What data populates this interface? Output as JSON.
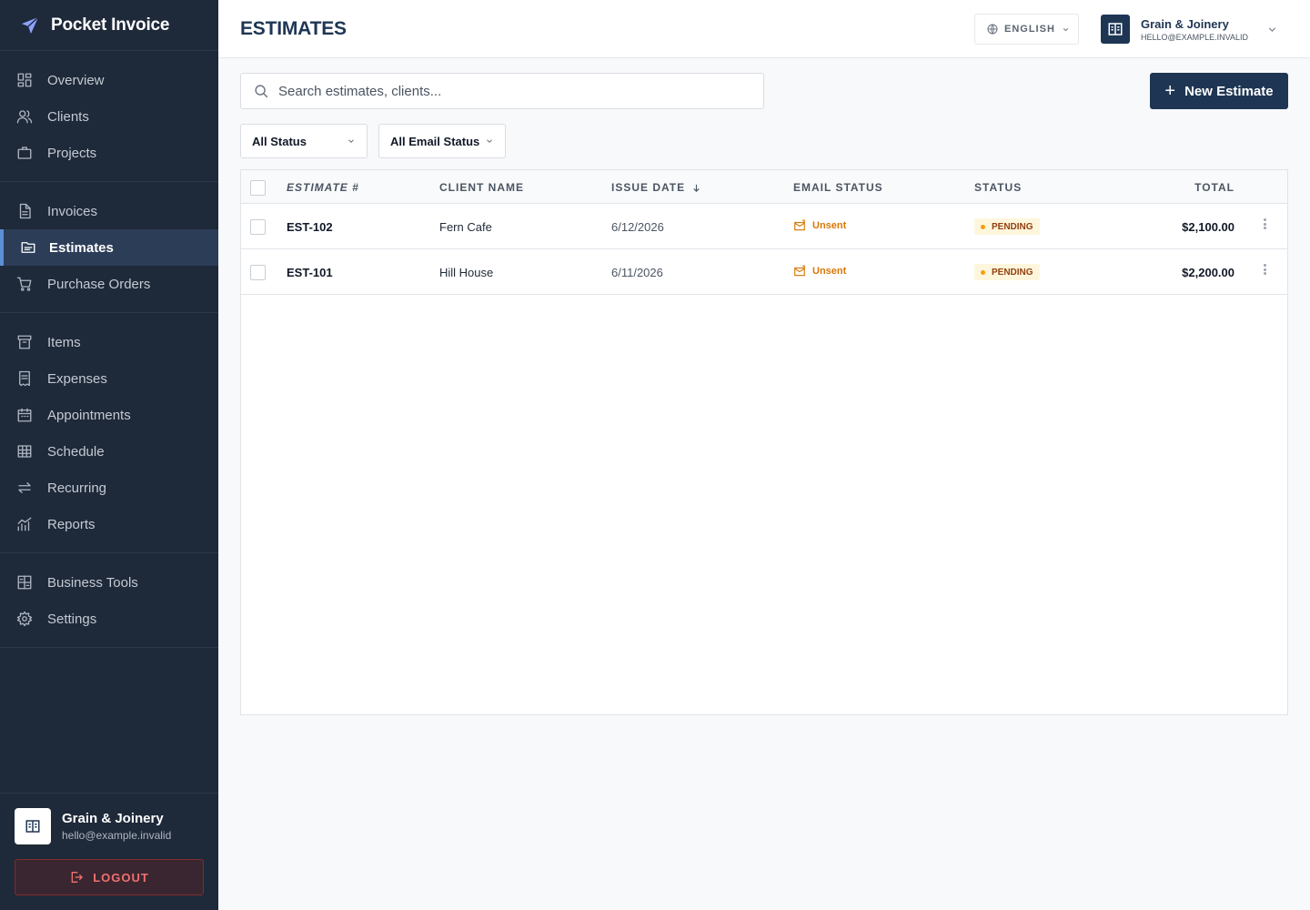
{
  "app": {
    "name": "Pocket Invoice"
  },
  "sidebar": {
    "groups": [
      [
        {
          "label": "Overview",
          "icon": "overview-icon"
        },
        {
          "label": "Clients",
          "icon": "clients-icon"
        },
        {
          "label": "Projects",
          "icon": "projects-icon"
        }
      ],
      [
        {
          "label": "Invoices",
          "icon": "invoices-icon"
        },
        {
          "label": "Estimates",
          "icon": "estimates-icon",
          "active": true
        },
        {
          "label": "Purchase Orders",
          "icon": "cart-icon"
        }
      ],
      [
        {
          "label": "Items",
          "icon": "items-icon"
        },
        {
          "label": "Expenses",
          "icon": "expenses-icon"
        },
        {
          "label": "Appointments",
          "icon": "calendar-icon"
        },
        {
          "label": "Schedule",
          "icon": "schedule-icon"
        },
        {
          "label": "Recurring",
          "icon": "recurring-icon"
        },
        {
          "label": "Reports",
          "icon": "reports-icon"
        }
      ],
      [
        {
          "label": "Business Tools",
          "icon": "tools-icon"
        },
        {
          "label": "Settings",
          "icon": "gear-icon"
        }
      ]
    ],
    "footer": {
      "business_name": "Grain & Joinery",
      "email": "hello@example.invalid",
      "logout_label": "LOGOUT"
    }
  },
  "header": {
    "title": "ESTIMATES",
    "language": "ENGLISH",
    "account_name": "Grain & Joinery",
    "account_email": "HELLO@EXAMPLE.INVALID"
  },
  "toolbar": {
    "search_placeholder": "Search estimates, clients...",
    "new_button_label": "New Estimate",
    "filter_status": "All Status",
    "filter_email_status": "All Email Status"
  },
  "table": {
    "columns": {
      "estimate": "ESTIMATE #",
      "client": "CLIENT NAME",
      "issue_date": "ISSUE DATE",
      "email_status": "EMAIL STATUS",
      "status": "STATUS",
      "total": "TOTAL"
    },
    "rows": [
      {
        "estimate": "EST-102",
        "client": "Fern Cafe",
        "issue_date": "6/12/2026",
        "email_status": "Unsent",
        "status": "PENDING",
        "total": "$2,100.00"
      },
      {
        "estimate": "EST-101",
        "client": "Hill House",
        "issue_date": "6/11/2026",
        "email_status": "Unsent",
        "status": "PENDING",
        "total": "$2,200.00"
      }
    ]
  },
  "colors": {
    "sidebar_bg": "#1e2939",
    "primary": "#1e3654",
    "accent": "#5b8fd8",
    "pending_bg": "#fef6dc",
    "pending_text": "#92400e",
    "unsent": "#d97706",
    "logout": "#f07070"
  }
}
